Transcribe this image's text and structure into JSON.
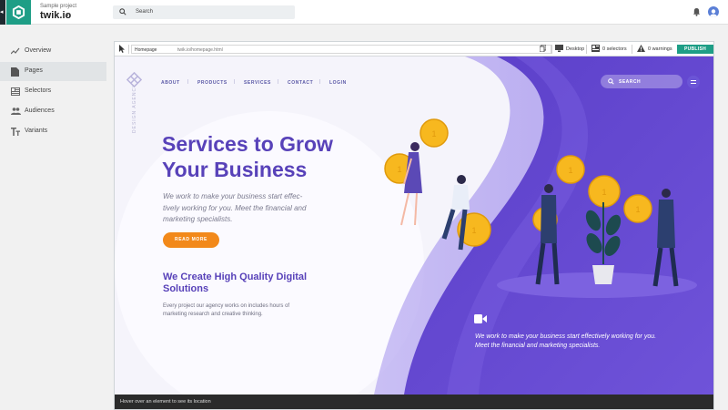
{
  "header": {
    "project_sub": "Sample project",
    "project_title": "twik.io",
    "search_placeholder": "Search"
  },
  "sidebar": {
    "items": [
      {
        "label": "Overview",
        "icon": "trending-icon"
      },
      {
        "label": "Pages",
        "icon": "page-icon",
        "active": true
      },
      {
        "label": "Selectors",
        "icon": "selectors-icon"
      },
      {
        "label": "Audiences",
        "icon": "people-icon"
      },
      {
        "label": "Variants",
        "icon": "text-variant-icon"
      }
    ]
  },
  "toolbar": {
    "page_name": "Homepage",
    "page_url": "twik.io/homepage.html",
    "device": "Desktop",
    "selectors": "0 selectors",
    "warnings": "0 warnings",
    "publish": "PUBLISH"
  },
  "site": {
    "brand_vertical": "DESIGN AGENCY",
    "nav": [
      "ABOUT",
      "PRODUCTS",
      "SERVICES",
      "CONTACT",
      "LOGIN"
    ],
    "nav_sep": "|",
    "search_label": "SEARCH",
    "hero_title": "Services to Grow Your Business",
    "hero_desc": "We work to make your business start effec-tively working for you. Meet the financial and marketing specialists.",
    "cta": "READ MORE",
    "sub_title": "We Create High Quality Digital Solutions",
    "sub_desc": "Every project our agency works on includes hours of marketing research and creative thinking.",
    "right_desc": "We work to make your business start effectively working for you. Meet the financial and marketing specialists.",
    "colors": {
      "primary": "#5842b9",
      "accent": "#f2891a",
      "teal": "#1e9e86"
    }
  },
  "status": {
    "hint": "Hover over an element to see its location"
  }
}
